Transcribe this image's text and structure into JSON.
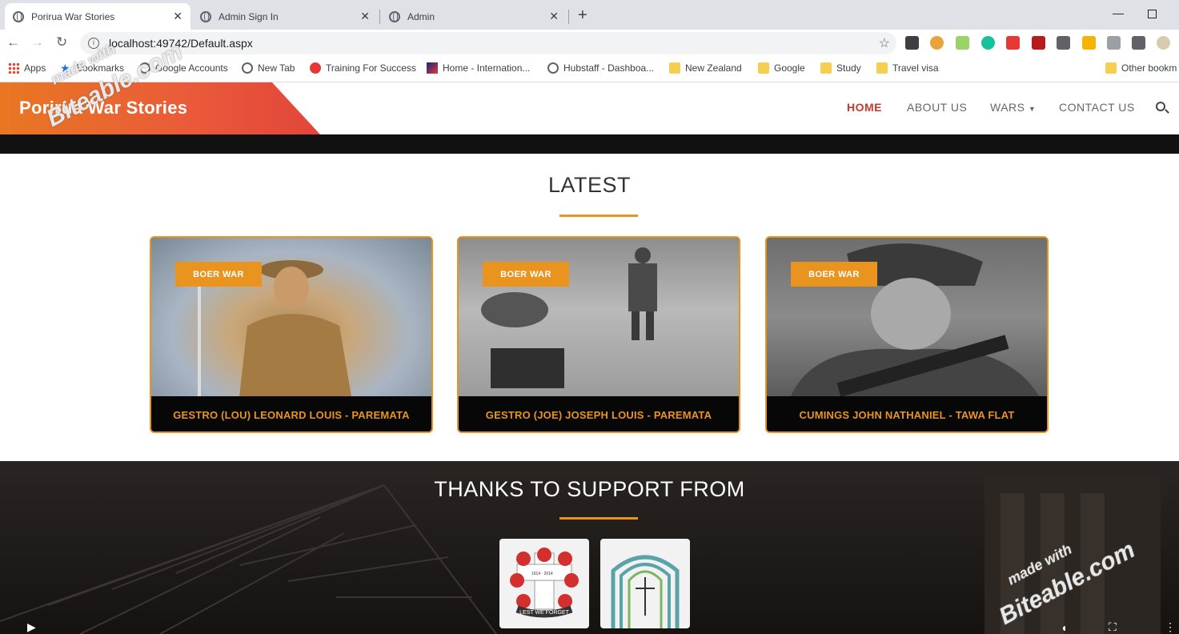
{
  "browser": {
    "tabs": [
      {
        "title": "Porirua War Stories"
      },
      {
        "title": "Admin Sign In"
      },
      {
        "title": "Admin"
      }
    ],
    "new_tab_label": "+",
    "url": "localhost:49742/Default.aspx",
    "bookmarks": [
      {
        "label": "Apps",
        "icon": "apps-grid-icon"
      },
      {
        "label": "Bookmarks",
        "icon": "star-icon"
      },
      {
        "label": "Google Accounts",
        "icon": "globe-icon"
      },
      {
        "label": "New Tab",
        "icon": "globe-icon"
      },
      {
        "label": "Training For Success",
        "icon": "tfs-icon"
      },
      {
        "label": "Home - Internation...",
        "icon": "plane-icon"
      },
      {
        "label": "Hubstaff - Dashboa...",
        "icon": "globe-icon"
      },
      {
        "label": "New Zealand",
        "icon": "folder-icon"
      },
      {
        "label": "Google",
        "icon": "folder-icon"
      },
      {
        "label": "Study",
        "icon": "folder-icon"
      },
      {
        "label": "Travel visa",
        "icon": "folder-icon"
      },
      {
        "label": "Other bookm",
        "icon": "folder-icon"
      }
    ]
  },
  "site": {
    "brand": "Porirua War Stories",
    "nav": [
      {
        "label": "HOME",
        "active": true
      },
      {
        "label": "ABOUT US",
        "active": false
      },
      {
        "label": "WARS",
        "active": false,
        "dropdown": true
      },
      {
        "label": "CONTACT US",
        "active": false
      }
    ],
    "latest": {
      "title": "LATEST",
      "cards": [
        {
          "badge": "BOER WAR",
          "caption": "GESTRO (LOU) LEONARD LOUIS - PAREMATA"
        },
        {
          "badge": "BOER WAR",
          "caption": "GESTRO (JOE) JOSEPH LOUIS - PAREMATA"
        },
        {
          "badge": "BOER WAR",
          "caption": "CUMINGS JOHN NATHANIEL - TAWA FLAT"
        }
      ]
    },
    "support": {
      "title": "THANKS TO SUPPORT FROM",
      "logo1_text": "LEST WE FORGET",
      "logo1_years": "1914 · 2014"
    }
  },
  "watermark": {
    "line1": "made with",
    "line2": "Biteable.com"
  },
  "colors": {
    "accent": "#e8941f",
    "active_nav": "#c8382e",
    "brand_grad_start": "#e87722",
    "brand_grad_end": "#e2453a"
  }
}
